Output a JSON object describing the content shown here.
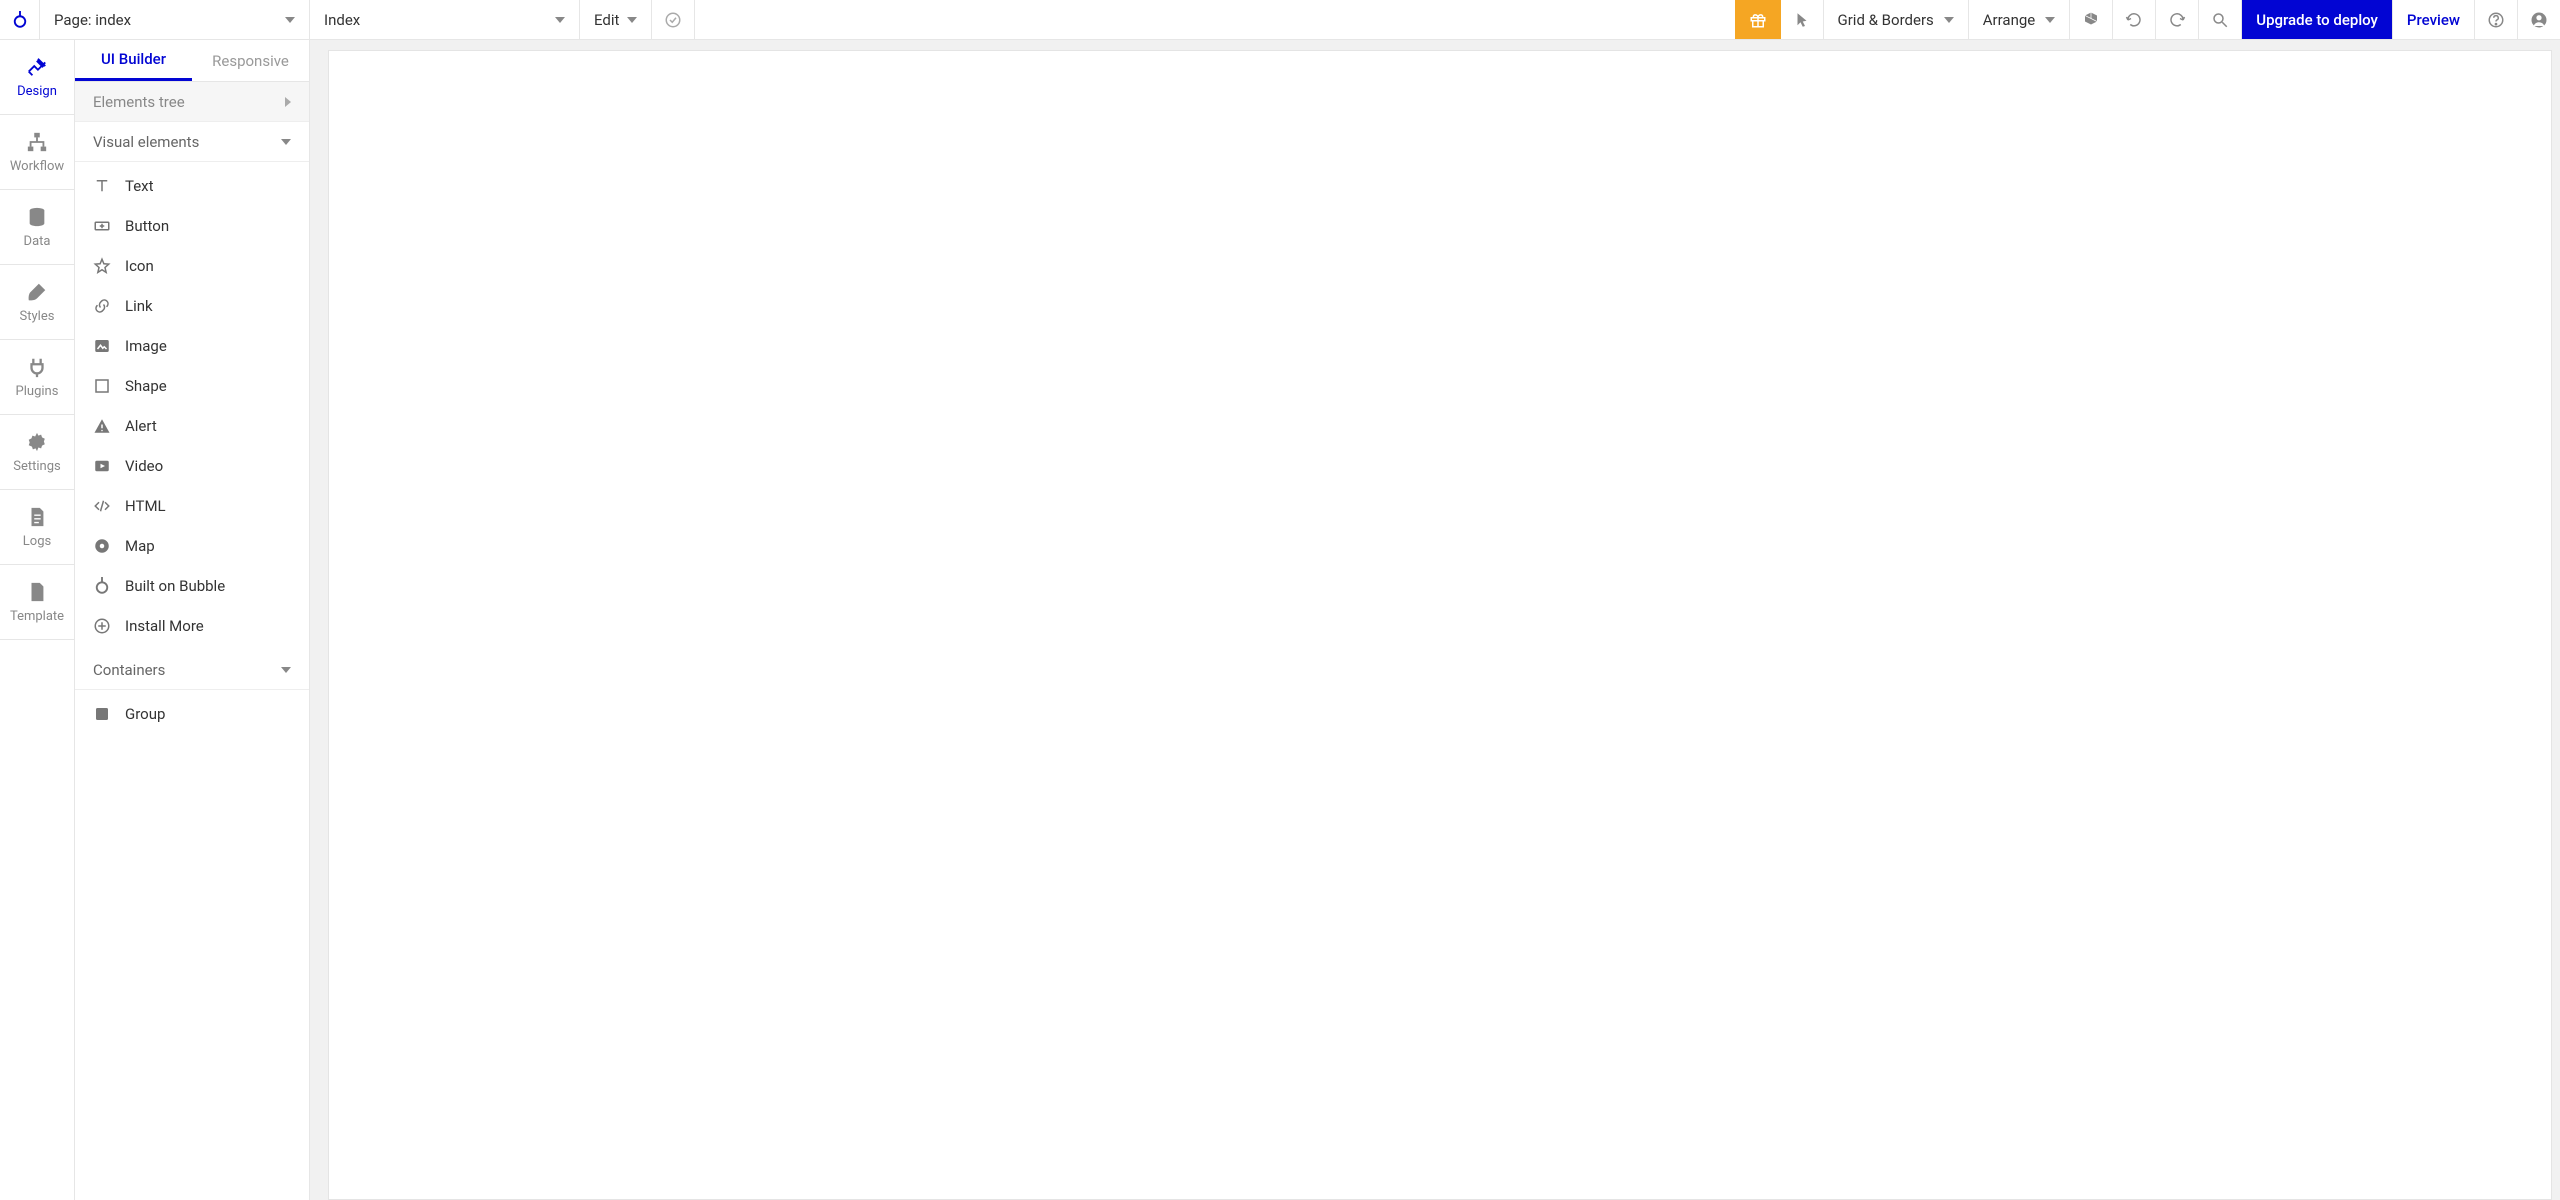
{
  "topbar": {
    "page_selector_label": "Page: index",
    "element_selector_label": "Index",
    "edit_label": "Edit",
    "grid_label": "Grid & Borders",
    "arrange_label": "Arrange",
    "upgrade_label": "Upgrade to deploy",
    "preview_label": "Preview"
  },
  "rail": {
    "items": [
      {
        "id": "design",
        "label": "Design"
      },
      {
        "id": "workflow",
        "label": "Workflow"
      },
      {
        "id": "data",
        "label": "Data"
      },
      {
        "id": "styles",
        "label": "Styles"
      },
      {
        "id": "plugins",
        "label": "Plugins"
      },
      {
        "id": "settings",
        "label": "Settings"
      },
      {
        "id": "logs",
        "label": "Logs"
      },
      {
        "id": "template",
        "label": "Template"
      }
    ],
    "active": "design"
  },
  "panel": {
    "tabs": {
      "ui_builder": "UI Builder",
      "responsive": "Responsive",
      "active": "ui_builder"
    },
    "elements_tree_label": "Elements tree",
    "sections": [
      {
        "title": "Visual elements",
        "items": [
          {
            "icon": "text",
            "label": "Text"
          },
          {
            "icon": "button",
            "label": "Button"
          },
          {
            "icon": "star",
            "label": "Icon"
          },
          {
            "icon": "link",
            "label": "Link"
          },
          {
            "icon": "image",
            "label": "Image"
          },
          {
            "icon": "shape",
            "label": "Shape"
          },
          {
            "icon": "alert",
            "label": "Alert"
          },
          {
            "icon": "video",
            "label": "Video"
          },
          {
            "icon": "html",
            "label": "HTML"
          },
          {
            "icon": "map",
            "label": "Map"
          },
          {
            "icon": "bubble",
            "label": "Built on Bubble"
          },
          {
            "icon": "plus",
            "label": "Install More"
          }
        ]
      },
      {
        "title": "Containers",
        "items": [
          {
            "icon": "group",
            "label": "Group"
          }
        ]
      }
    ]
  }
}
